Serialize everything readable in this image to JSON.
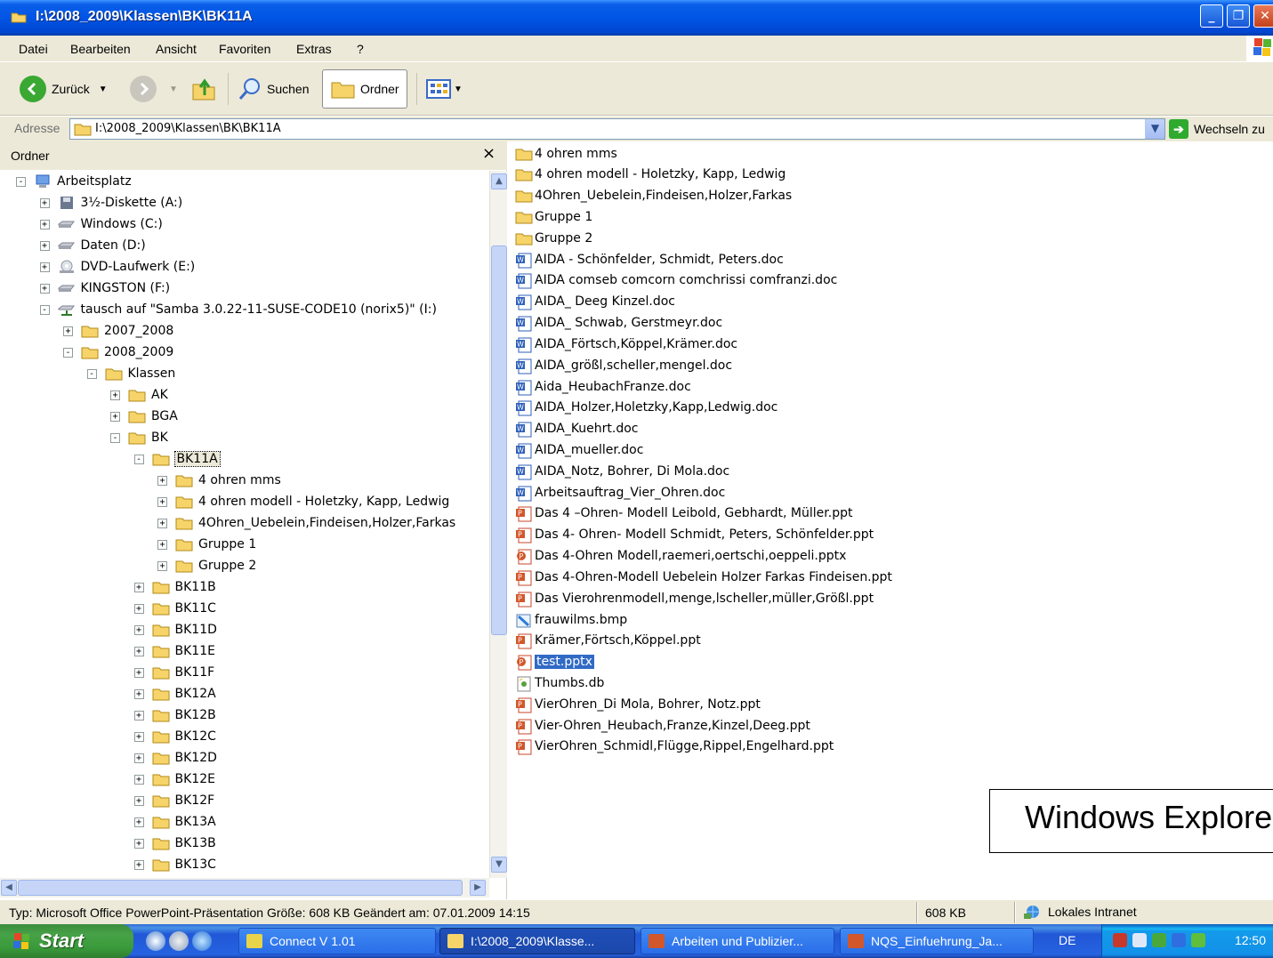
{
  "window": {
    "title": "I:\\2008_2009\\Klassen\\BK\\BK11A"
  },
  "menu": [
    "Datei",
    "Bearbeiten",
    "Ansicht",
    "Favoriten",
    "Extras",
    "?"
  ],
  "toolbar": {
    "back": "Zurück",
    "search": "Suchen",
    "folders": "Ordner"
  },
  "address": {
    "label": "Adresse",
    "value": "I:\\2008_2009\\Klassen\\BK\\BK11A",
    "go": "Wechseln zu"
  },
  "left_pane": {
    "title": "Ordner",
    "tree": [
      {
        "label": "Arbeitsplatz",
        "level": 0,
        "state": "-",
        "icon": "computer-icon"
      },
      {
        "label": "3½-Diskette (A:)",
        "level": 1,
        "state": "+",
        "icon": "floppy-icon"
      },
      {
        "label": "Windows (C:)",
        "level": 1,
        "state": "+",
        "icon": "drive-icon"
      },
      {
        "label": "Daten (D:)",
        "level": 1,
        "state": "+",
        "icon": "drive-icon"
      },
      {
        "label": "DVD-Laufwerk (E:)",
        "level": 1,
        "state": "+",
        "icon": "dvd-icon"
      },
      {
        "label": "KINGSTON (F:)",
        "level": 1,
        "state": "+",
        "icon": "drive-icon"
      },
      {
        "label": "tausch auf \"Samba 3.0.22-11-SUSE-CODE10 (norix5)\" (I:)",
        "level": 1,
        "state": "-",
        "icon": "network-drive-icon"
      },
      {
        "label": "2007_2008",
        "level": 2,
        "state": "+",
        "icon": "folder-icon"
      },
      {
        "label": "2008_2009",
        "level": 2,
        "state": "-",
        "icon": "folder-icon"
      },
      {
        "label": "Klassen",
        "level": 3,
        "state": "-",
        "icon": "folder-icon"
      },
      {
        "label": "AK",
        "level": 4,
        "state": "+",
        "icon": "folder-icon"
      },
      {
        "label": "BGA",
        "level": 4,
        "state": "+",
        "icon": "folder-icon"
      },
      {
        "label": "BK",
        "level": 4,
        "state": "-",
        "icon": "folder-icon"
      },
      {
        "label": "BK11A",
        "level": 5,
        "state": "-",
        "icon": "folder-icon",
        "selected": true
      },
      {
        "label": "4 ohren mms",
        "level": 6,
        "state": "+",
        "icon": "folder-icon"
      },
      {
        "label": "4 ohren modell - Holetzky, Kapp, Ledwig",
        "level": 6,
        "state": "+",
        "icon": "folder-icon"
      },
      {
        "label": "4Ohren_Uebelein,Findeisen,Holzer,Farkas",
        "level": 6,
        "state": "+",
        "icon": "folder-icon"
      },
      {
        "label": "Gruppe 1",
        "level": 6,
        "state": "+",
        "icon": "folder-icon"
      },
      {
        "label": "Gruppe 2",
        "level": 6,
        "state": "+",
        "icon": "folder-icon"
      },
      {
        "label": "BK11B",
        "level": 5,
        "state": "+",
        "icon": "folder-icon"
      },
      {
        "label": "BK11C",
        "level": 5,
        "state": "+",
        "icon": "folder-icon"
      },
      {
        "label": "BK11D",
        "level": 5,
        "state": "+",
        "icon": "folder-icon"
      },
      {
        "label": "BK11E",
        "level": 5,
        "state": "+",
        "icon": "folder-icon"
      },
      {
        "label": "BK11F",
        "level": 5,
        "state": "+",
        "icon": "folder-icon"
      },
      {
        "label": "BK12A",
        "level": 5,
        "state": "+",
        "icon": "folder-icon"
      },
      {
        "label": "BK12B",
        "level": 5,
        "state": "+",
        "icon": "folder-icon"
      },
      {
        "label": "BK12C",
        "level": 5,
        "state": "+",
        "icon": "folder-icon"
      },
      {
        "label": "BK12D",
        "level": 5,
        "state": "+",
        "icon": "folder-icon"
      },
      {
        "label": "BK12E",
        "level": 5,
        "state": "+",
        "icon": "folder-icon"
      },
      {
        "label": "BK12F",
        "level": 5,
        "state": "+",
        "icon": "folder-icon"
      },
      {
        "label": "BK13A",
        "level": 5,
        "state": "+",
        "icon": "folder-icon"
      },
      {
        "label": "BK13B",
        "level": 5,
        "state": "+",
        "icon": "folder-icon"
      },
      {
        "label": "BK13C",
        "level": 5,
        "state": "+",
        "icon": "folder-icon"
      }
    ]
  },
  "files": [
    {
      "name": "4 ohren mms",
      "type": "folder"
    },
    {
      "name": "4 ohren modell - Holetzky, Kapp, Ledwig",
      "type": "folder"
    },
    {
      "name": "4Ohren_Uebelein,Findeisen,Holzer,Farkas",
      "type": "folder"
    },
    {
      "name": "Gruppe 1",
      "type": "folder"
    },
    {
      "name": "Gruppe 2",
      "type": "folder"
    },
    {
      "name": "AIDA - Schönfelder, Schmidt, Peters.doc",
      "type": "doc"
    },
    {
      "name": "AIDA comseb comcorn comchrissi comfranzi.doc",
      "type": "doc"
    },
    {
      "name": "AIDA_ Deeg Kinzel.doc",
      "type": "doc"
    },
    {
      "name": "AIDA_ Schwab, Gerstmeyr.doc",
      "type": "doc"
    },
    {
      "name": "AIDA_Förtsch,Köppel,Krämer.doc",
      "type": "doc"
    },
    {
      "name": "AIDA_größl,scheller,mengel.doc",
      "type": "doc"
    },
    {
      "name": "Aida_HeubachFranze.doc",
      "type": "doc"
    },
    {
      "name": "AIDA_Holzer,Holetzky,Kapp,Ledwig.doc",
      "type": "doc"
    },
    {
      "name": "AIDA_Kuehrt.doc",
      "type": "doc"
    },
    {
      "name": "AIDA_mueller.doc",
      "type": "doc"
    },
    {
      "name": "AIDA_Notz, Bohrer, Di Mola.doc",
      "type": "doc"
    },
    {
      "name": "Arbeitsauftrag_Vier_Ohren.doc",
      "type": "doc"
    },
    {
      "name": "Das 4 –Ohren- Modell Leibold, Gebhardt, Müller.ppt",
      "type": "ppt"
    },
    {
      "name": "Das 4- Ohren- Modell Schmidt, Peters, Schönfelder.ppt",
      "type": "ppt"
    },
    {
      "name": "Das 4-Ohren Modell,raemeri,oertschi,oeppeli.pptx",
      "type": "pptx"
    },
    {
      "name": "Das 4-Ohren-Modell Uebelein Holzer Farkas Findeisen.ppt",
      "type": "ppt"
    },
    {
      "name": "Das Vierohrenmodell,menge,lscheller,müller,Größl.ppt",
      "type": "ppt"
    },
    {
      "name": "frauwilms.bmp",
      "type": "bmp"
    },
    {
      "name": "Krämer,Förtsch,Köppel.ppt",
      "type": "ppt"
    },
    {
      "name": "test.pptx",
      "type": "pptx",
      "selected": true
    },
    {
      "name": "Thumbs.db",
      "type": "db"
    },
    {
      "name": "VierOhren_Di Mola, Bohrer, Notz.ppt",
      "type": "ppt"
    },
    {
      "name": "Vier-Ohren_Heubach,Franze,Kinzel,Deeg.ppt",
      "type": "ppt"
    },
    {
      "name": "VierOhren_Schmidl,Flügge,Rippel,Engelhard.ppt",
      "type": "ppt"
    }
  ],
  "callout": {
    "text": "Windows Explorer"
  },
  "status": {
    "info": "Typ: Microsoft Office PowerPoint-Präsentation Größe: 608 KB Geändert am: 07.01.2009 14:15",
    "size": "608 KB",
    "zone": "Lokales Intranet"
  },
  "taskbar": {
    "start": "Start",
    "tasks": [
      {
        "label": "Connect V 1.01",
        "active": false
      },
      {
        "label": "I:\\2008_2009\\Klasse...",
        "active": true
      },
      {
        "label": "Arbeiten und Publizier...",
        "active": false
      },
      {
        "label": "NQS_Einfuehrung_Ja...",
        "active": false
      }
    ],
    "lang": "DE",
    "clock": "12:50"
  },
  "colors": {
    "title_blue": "#0055e5",
    "selection": "#316ac5",
    "chrome": "#ece9d8",
    "start_green": "#3a9a3a"
  }
}
